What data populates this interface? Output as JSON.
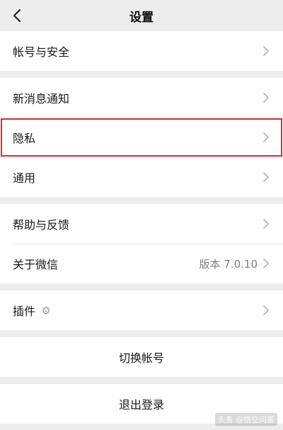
{
  "nav": {
    "title": "设置"
  },
  "groups": [
    {
      "items": [
        {
          "label": "帐号与安全"
        }
      ]
    },
    {
      "items": [
        {
          "label": "新消息通知"
        },
        {
          "label": "隐私"
        },
        {
          "label": "通用"
        }
      ]
    },
    {
      "items": [
        {
          "label": "帮助与反馈"
        },
        {
          "label": "关于微信",
          "value": "版本 7.0.10"
        }
      ]
    },
    {
      "items": [
        {
          "label": "插件"
        }
      ]
    }
  ],
  "actions": {
    "switch_account": "切换帐号",
    "logout": "退出登录"
  },
  "watermark": "头条 @悟空问答",
  "colors": {
    "background": "#ededed",
    "highlight": "#d0312d",
    "chevron": "#b2b2b2"
  }
}
